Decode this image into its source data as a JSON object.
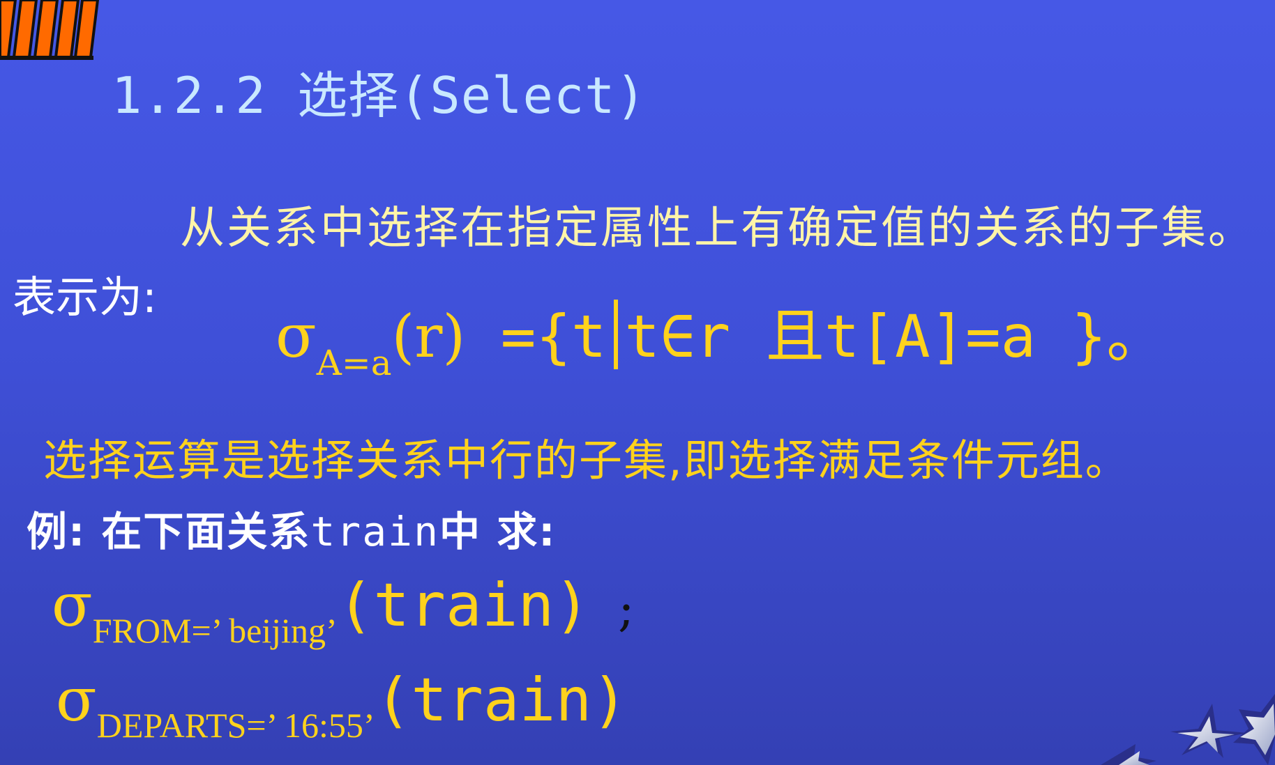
{
  "slide": {
    "title": "1.2.2 选择(Select)",
    "description": "从关系中选择在指定属性上有确定值的关系的子集。",
    "repr_label": "表示为:",
    "formula": {
      "sigma": "σ",
      "subscript": "A=a",
      "arg": "(r)",
      "eq": " ={t",
      "rest": "t∈r 且t[A]=a }。"
    },
    "sentence": "选择运算是选择关系中行的子集,即选择满足条件元组。",
    "example": {
      "prefix": "例: 在下面关系",
      "relation": "train",
      "suffix": "中 求:"
    },
    "expressions": [
      {
        "sigma": "σ",
        "subscript": "FROM=’ beijing’",
        "arg": "(train)",
        "terminator": ";"
      },
      {
        "sigma": "σ",
        "subscript": "DEPARTS=’ 16:55’",
        "arg": "(train)",
        "terminator": ""
      }
    ],
    "colors": {
      "background_top": "#4658e6",
      "background_bottom": "#3440b4",
      "title": "#c9e8ff",
      "accent_yellow": "#ffd21c",
      "stripes": "#ff6a00"
    }
  }
}
